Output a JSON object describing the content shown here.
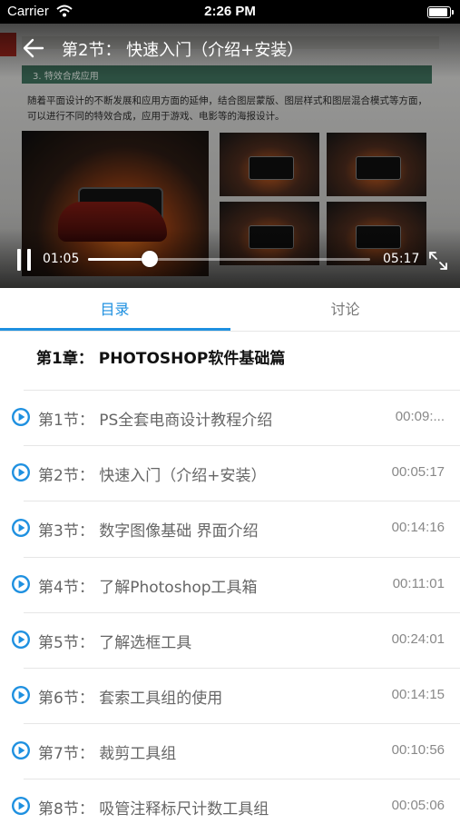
{
  "status_bar": {
    "carrier": "Carrier",
    "time": "2:26 PM"
  },
  "player": {
    "title": "第2节：  快速入门（介绍+安装）",
    "current_time": "01:05",
    "duration": "05:17",
    "progress": 0.22
  },
  "slide": {
    "section_heading": "3. 特效合成应用",
    "paragraph": "随着平面设计的不断发展和应用方面的延伸，结合图层蒙版、图层样式和图层混合模式等方面，可以进行不同的特效合成，应用于游戏、电影等的海报设计。"
  },
  "tabs": [
    {
      "label": "目录",
      "active": true
    },
    {
      "label": "讨论",
      "active": false
    }
  ],
  "chapter": {
    "title": "第1章：  PHOTOSHOP软件基础篇"
  },
  "lessons": [
    {
      "label": "第1节：  PS全套电商设计教程介绍",
      "duration": "00:09:..."
    },
    {
      "label": "第2节：  快速入门（介绍+安装）",
      "duration": "00:05:17"
    },
    {
      "label": "第3节：  数字图像基础 界面介绍",
      "duration": "00:14:16"
    },
    {
      "label": "第4节：  了解Photoshop工具箱",
      "duration": "00:11:01"
    },
    {
      "label": "第5节：  了解选框工具",
      "duration": "00:24:01"
    },
    {
      "label": "第6节：  套索工具组的使用",
      "duration": "00:14:15"
    },
    {
      "label": "第7节：  裁剪工具组",
      "duration": "00:10:56"
    },
    {
      "label": "第8节：  吸管注释标尺计数工具组",
      "duration": "00:05:06"
    }
  ],
  "colors": {
    "accent": "#1e90e0"
  },
  "icons": {
    "back": "back-arrow-icon",
    "pause": "pause-icon",
    "fullscreen": "fullscreen-icon",
    "play": "play-circle-icon",
    "wifi": "wifi-icon",
    "battery": "battery-icon"
  }
}
